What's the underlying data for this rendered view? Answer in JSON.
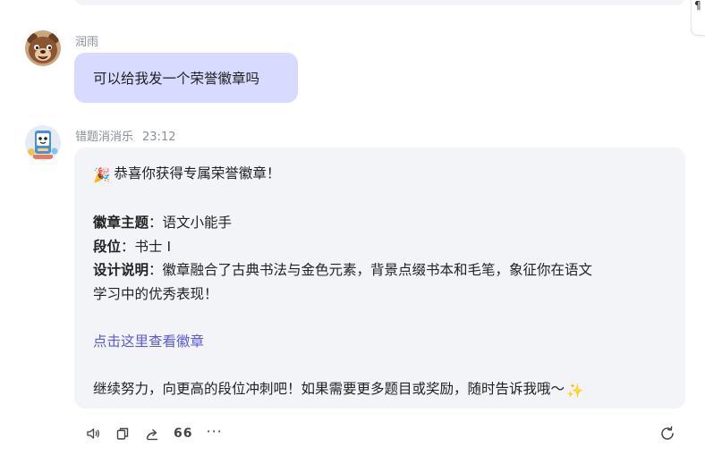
{
  "previous_message": {},
  "side_widget": {
    "glyph": "¶"
  },
  "user_message": {
    "sender": "润雨",
    "avatar_icon": "bear-avatar-icon",
    "text": "可以给我发一个荣誉徽章吗",
    "bubble_color": "#d8dbff"
  },
  "bot_message": {
    "sender": "错题消消乐",
    "time": "23:12",
    "avatar_icon": "robot-book-avatar-icon",
    "bubble_color": "#f3f4f7",
    "greeting_emoji": "🎉",
    "greeting": "恭喜你获得专属荣誉徽章！",
    "theme_label": "徽章主题",
    "theme_value": "：语文小能手",
    "rank_label": "段位",
    "rank_value": "：书士 I",
    "design_label": "设计说明",
    "design_value_1": "：徽章融合了古典书法与金色元素，背景点缀书本和毛笔，象征你在语文",
    "design_value_2": "学习中的优秀表现！",
    "link_text": "点击这里查看徽章",
    "link_color": "#5a5bd8",
    "closing": "继续努力，向更高的段位冲刺吧！如果需要更多题目或奖励，随时告诉我哦～",
    "closing_emoji": "✨"
  },
  "actions": {
    "speak_icon": "speaker-icon",
    "copy_icon": "copy-icon",
    "share_icon": "share-icon",
    "quote_label": "66",
    "more_label": "···",
    "regenerate_icon": "refresh-icon"
  }
}
